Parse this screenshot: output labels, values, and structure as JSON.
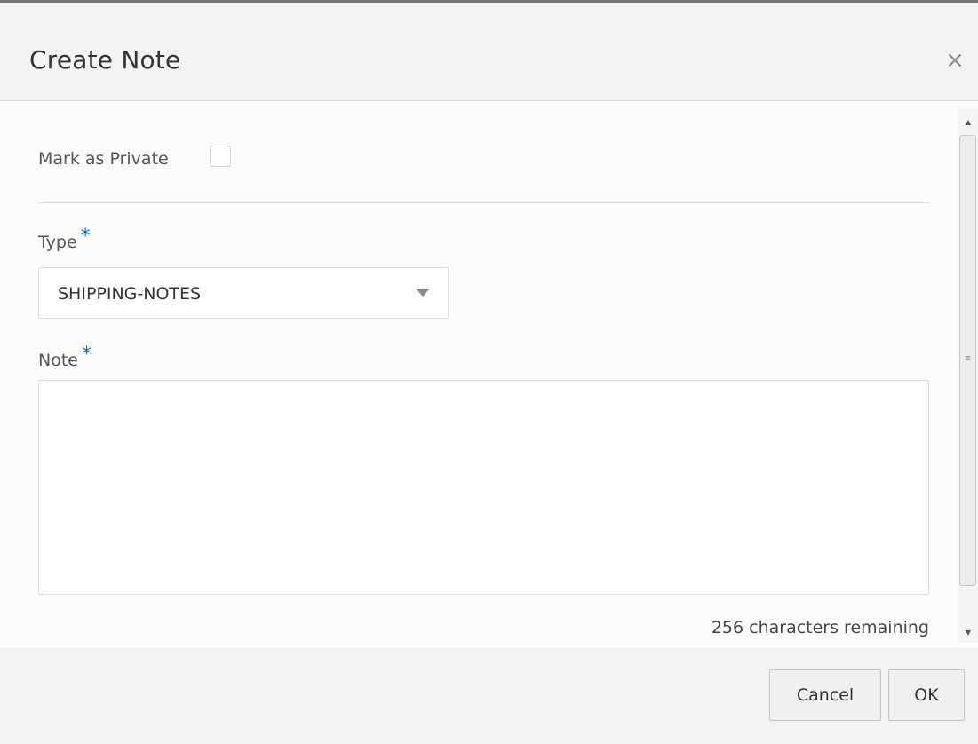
{
  "dialog": {
    "title": "Create Note",
    "close_glyph": "×"
  },
  "form": {
    "private": {
      "label": "Mark as Private",
      "checked": false
    },
    "type": {
      "label": "Type",
      "required_marker": "*",
      "selected_value": "SHIPPING-NOTES"
    },
    "note": {
      "label": "Note",
      "required_marker": "*",
      "value": "",
      "counter_text": "256 characters remaining"
    }
  },
  "footer": {
    "cancel_label": "Cancel",
    "ok_label": "OK"
  },
  "icons": {
    "close": "close-icon",
    "dropdown": "triangle-down-icon",
    "scroll_up": "scroll-up-arrow-icon",
    "scroll_down": "scroll-down-arrow-icon"
  },
  "colors": {
    "required_asterisk": "#0b6fc0",
    "header_bg": "#f3f3f3"
  }
}
